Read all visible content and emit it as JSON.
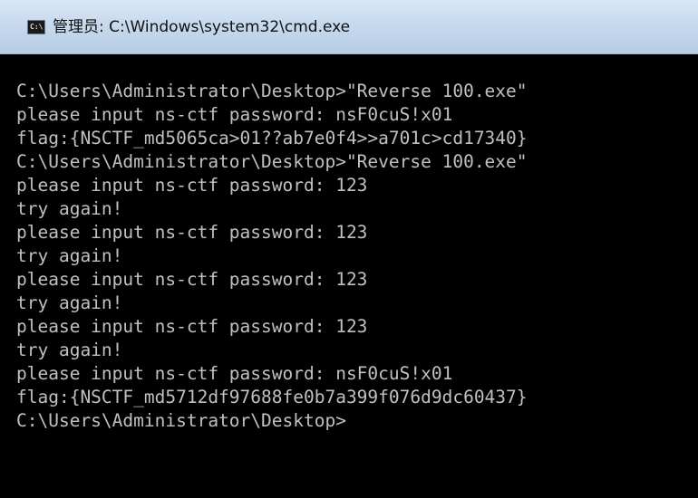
{
  "window": {
    "title": "管理员: C:\\Windows\\system32\\cmd.exe",
    "icon": "cmd-console-icon",
    "icon_text": "C:\\",
    "colors": {
      "titlebar": "#c4d7ec",
      "console_background": "#000000",
      "console_text": "#c0c0c0"
    }
  },
  "console": {
    "lines": [
      "C:\\Users\\Administrator\\Desktop>\"Reverse 100.exe\"",
      "please input ns-ctf password: nsF0cuS!x01",
      "flag:{NSCTF_md5065ca>01??ab7e0f4>>a701c>cd17340}",
      "C:\\Users\\Administrator\\Desktop>\"Reverse 100.exe\"",
      "please input ns-ctf password: 123",
      "try again!",
      "please input ns-ctf password: 123",
      "try again!",
      "please input ns-ctf password: 123",
      "try again!",
      "please input ns-ctf password: 123",
      "try again!",
      "please input ns-ctf password: nsF0cuS!x01",
      "flag:{NSCTF_md5712df97688fe0b7a399f076d9dc60437}",
      "C:\\Users\\Administrator\\Desktop>"
    ]
  }
}
